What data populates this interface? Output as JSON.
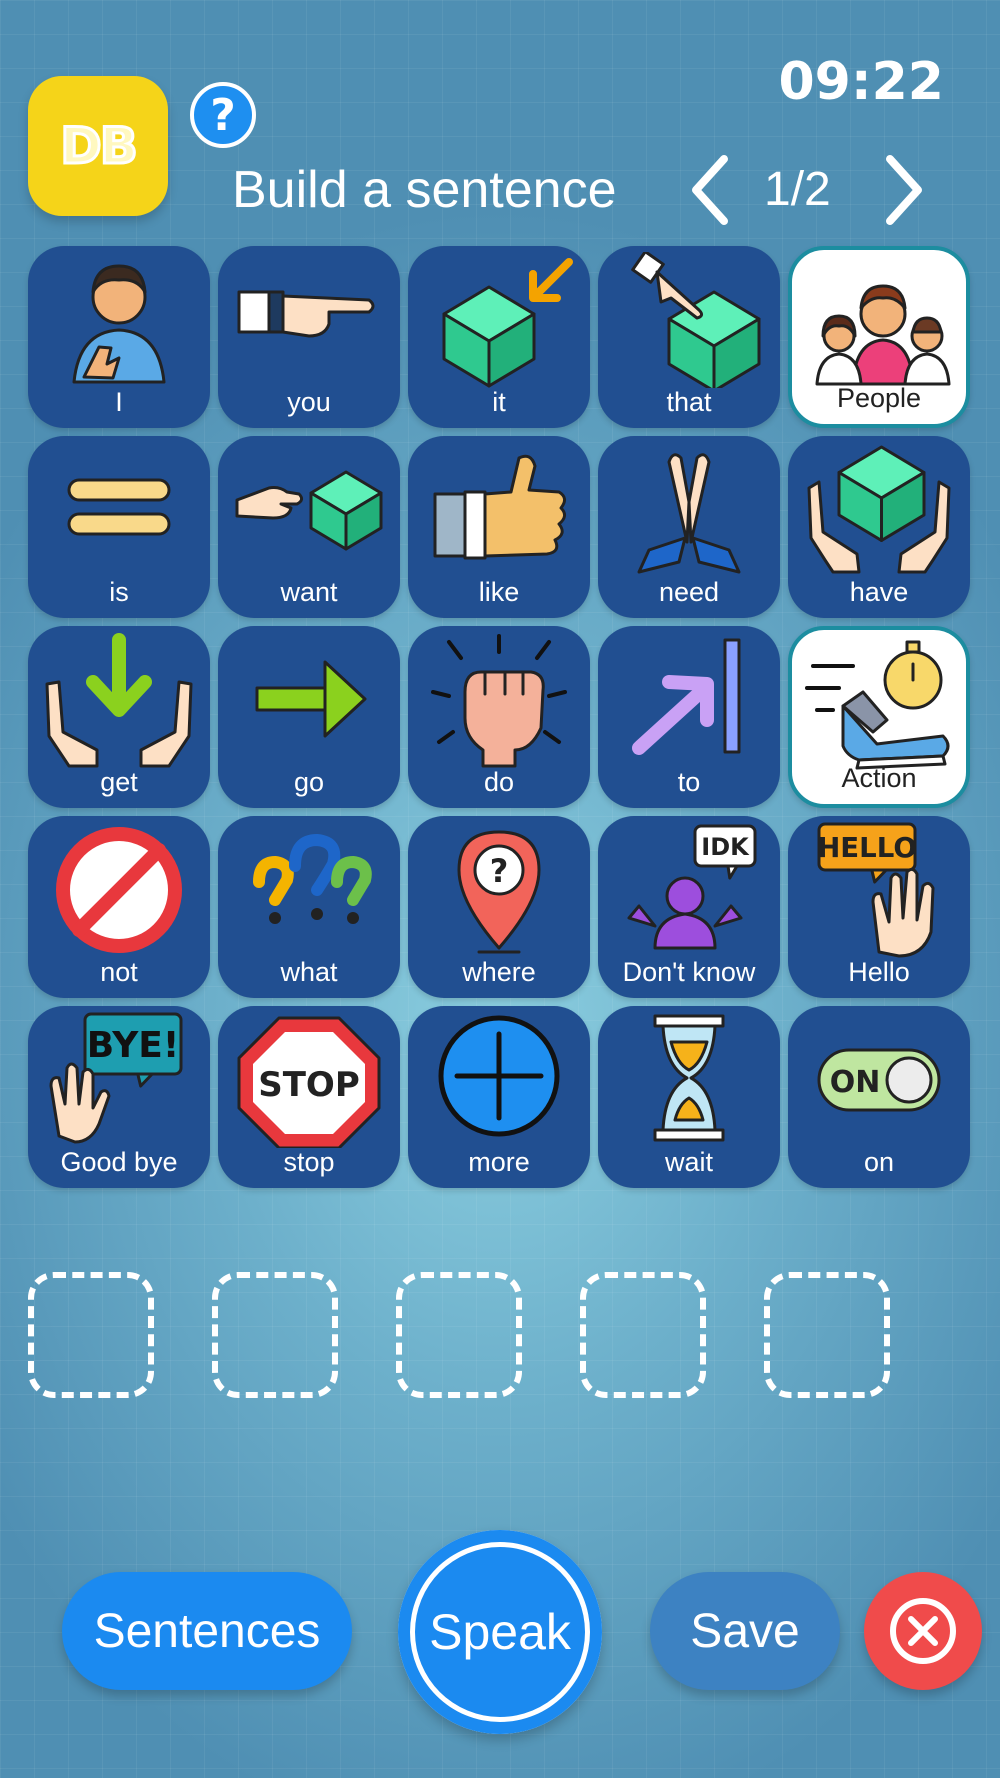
{
  "app": {
    "logo_text": "DB",
    "help_symbol": "?",
    "clock": "09:22",
    "title": "Build a sentence",
    "page_indicator": "1/2"
  },
  "tiles": [
    {
      "label": "I",
      "icon": "person-pointing-self-icon",
      "category": false
    },
    {
      "label": "you",
      "icon": "hand-pointing-icon",
      "category": false
    },
    {
      "label": "it",
      "icon": "cube-arrow-icon",
      "category": false
    },
    {
      "label": "that",
      "icon": "finger-on-cube-icon",
      "category": false
    },
    {
      "label": "People",
      "icon": "people-group-icon",
      "category": true
    },
    {
      "label": "is",
      "icon": "equals-icon",
      "category": false
    },
    {
      "label": "want",
      "icon": "hand-reaching-cube-icon",
      "category": false
    },
    {
      "label": "like",
      "icon": "thumbs-up-icon",
      "category": false
    },
    {
      "label": "need",
      "icon": "praying-hands-icon",
      "category": false
    },
    {
      "label": "have",
      "icon": "hands-holding-cube-icon",
      "category": false
    },
    {
      "label": "get",
      "icon": "hands-receiving-arrow-icon",
      "category": false
    },
    {
      "label": "go",
      "icon": "right-arrow-icon",
      "category": false
    },
    {
      "label": "do",
      "icon": "raised-fist-icon",
      "category": false
    },
    {
      "label": "to",
      "icon": "arrow-to-line-icon",
      "category": false
    },
    {
      "label": "Action",
      "icon": "running-shoe-stopwatch-icon",
      "category": true
    },
    {
      "label": "not",
      "icon": "prohibited-icon",
      "category": false
    },
    {
      "label": "what",
      "icon": "question-marks-icon",
      "category": false
    },
    {
      "label": "where",
      "icon": "map-pin-question-icon",
      "category": false
    },
    {
      "label": "Don't know",
      "icon": "shrugging-person-idk-icon",
      "category": false,
      "bubble": "IDK"
    },
    {
      "label": "Hello",
      "icon": "waving-hand-hello-icon",
      "category": false,
      "bubble": "HELLO"
    },
    {
      "label": "Good bye",
      "icon": "waving-hand-bye-icon",
      "category": false,
      "bubble": "BYE!"
    },
    {
      "label": "stop",
      "icon": "stop-sign-icon",
      "category": false,
      "bubble": "STOP"
    },
    {
      "label": "more",
      "icon": "plus-circle-icon",
      "category": false
    },
    {
      "label": "wait",
      "icon": "hourglass-icon",
      "category": false
    },
    {
      "label": "on",
      "icon": "toggle-on-icon",
      "category": false,
      "bubble": "ON"
    }
  ],
  "sentence_slots": 5,
  "buttons": {
    "sentences": "Sentences",
    "speak": "Speak",
    "save": "Save"
  },
  "colors": {
    "tile": "#214f91",
    "primary_button": "#1b8af0",
    "save_button": "#3d82c2",
    "close_button": "#f04b4b",
    "logo": "#f5d419",
    "category_border": "#1c8da0"
  }
}
